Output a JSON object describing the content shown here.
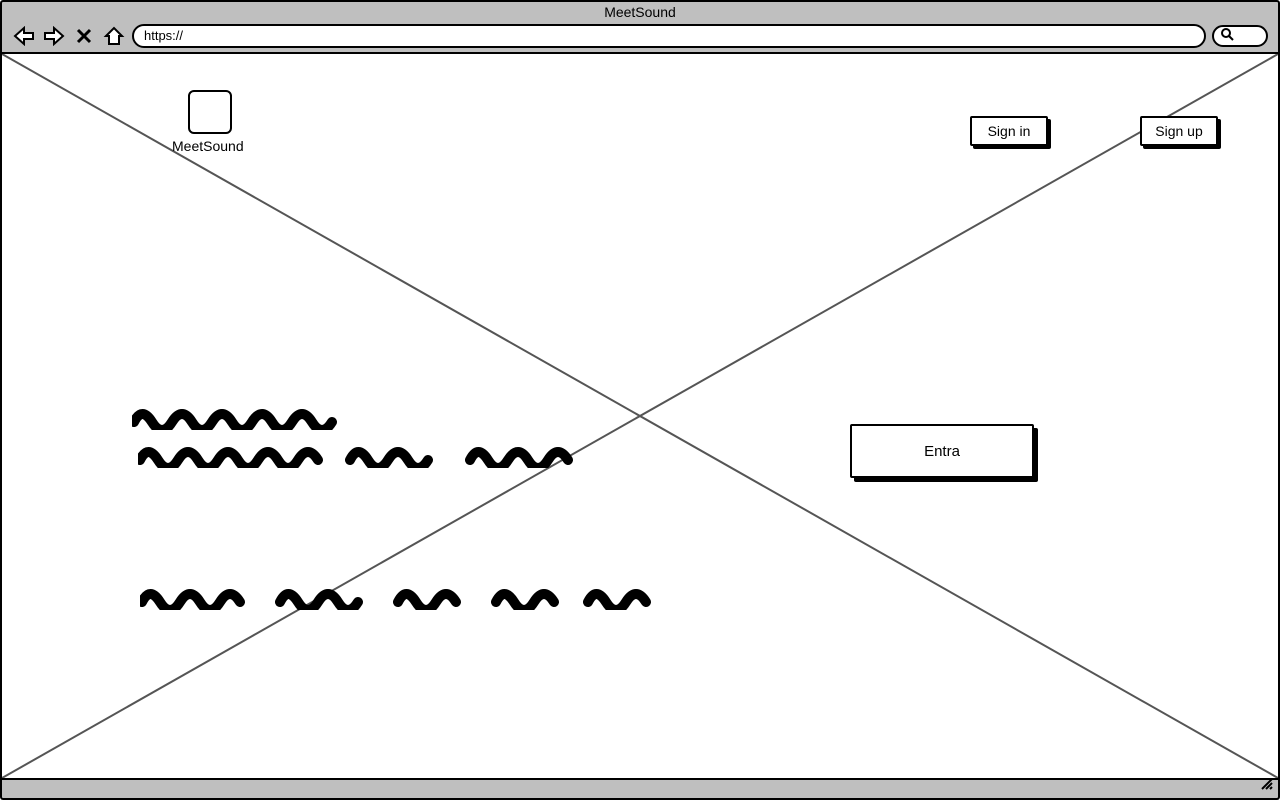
{
  "browser": {
    "title": "MeetSound",
    "url": "https://"
  },
  "header": {
    "logo_label": "MeetSound",
    "sign_in": "Sign in",
    "sign_up": "Sign up"
  },
  "hero": {
    "cta": "Entra"
  }
}
